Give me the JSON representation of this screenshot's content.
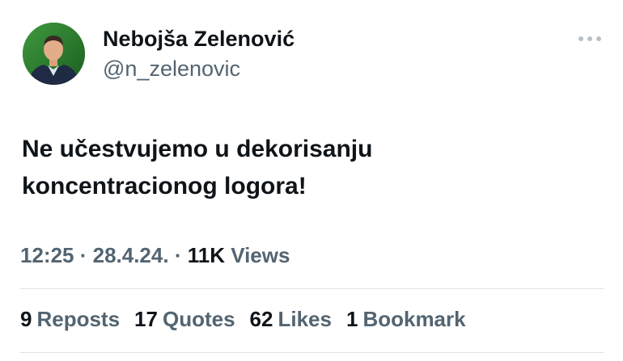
{
  "author": {
    "display_name": "Nebojša Zelenović",
    "handle": "@n_zelenovic"
  },
  "icons": {
    "more": "more-horizontal-icon"
  },
  "tweet": {
    "line1": "Ne učestvujemo u dekorisanju",
    "line2": "koncentracionog logora!"
  },
  "meta": {
    "time": "12:25",
    "sep1": " · ",
    "date": "28.4.24.",
    "sep2": " · ",
    "views_count": "11K",
    "views_label": " Views"
  },
  "stats": {
    "reposts_count": "9",
    "reposts_label": "Reposts",
    "quotes_count": "17",
    "quotes_label": "Quotes",
    "likes_count": "62",
    "likes_label": "Likes",
    "bookmarks_count": "1",
    "bookmarks_label": "Bookmark"
  },
  "colors": {
    "primary_text": "#0f1419",
    "secondary_text": "#536471",
    "divider": "#dde3e8",
    "avatar_bg": "#2e7d32"
  }
}
